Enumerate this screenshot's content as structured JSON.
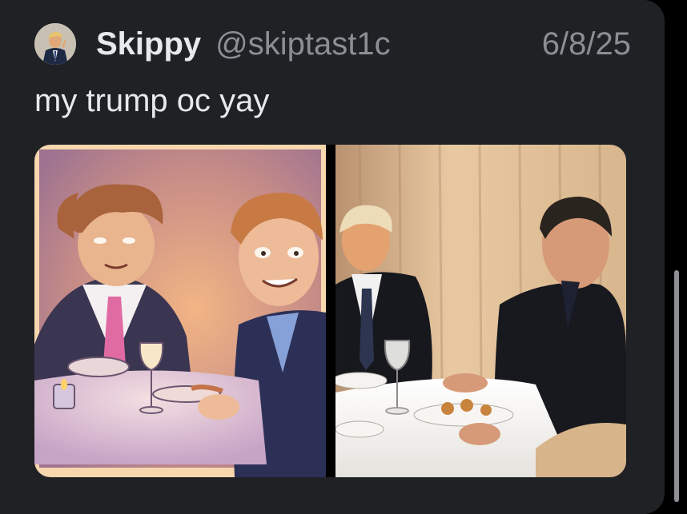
{
  "tweet": {
    "author_name": "Skippy",
    "author_handle": "@skiptast1c",
    "date": "6/8/25",
    "text": "my trump oc yay"
  },
  "media": {
    "left_image": "cartoon-illustration-dinner",
    "right_image": "dinner-photo"
  },
  "colors": {
    "card_bg": "#1f2125",
    "text_primary": "#e7e9ea",
    "text_secondary": "#8b8f94"
  }
}
